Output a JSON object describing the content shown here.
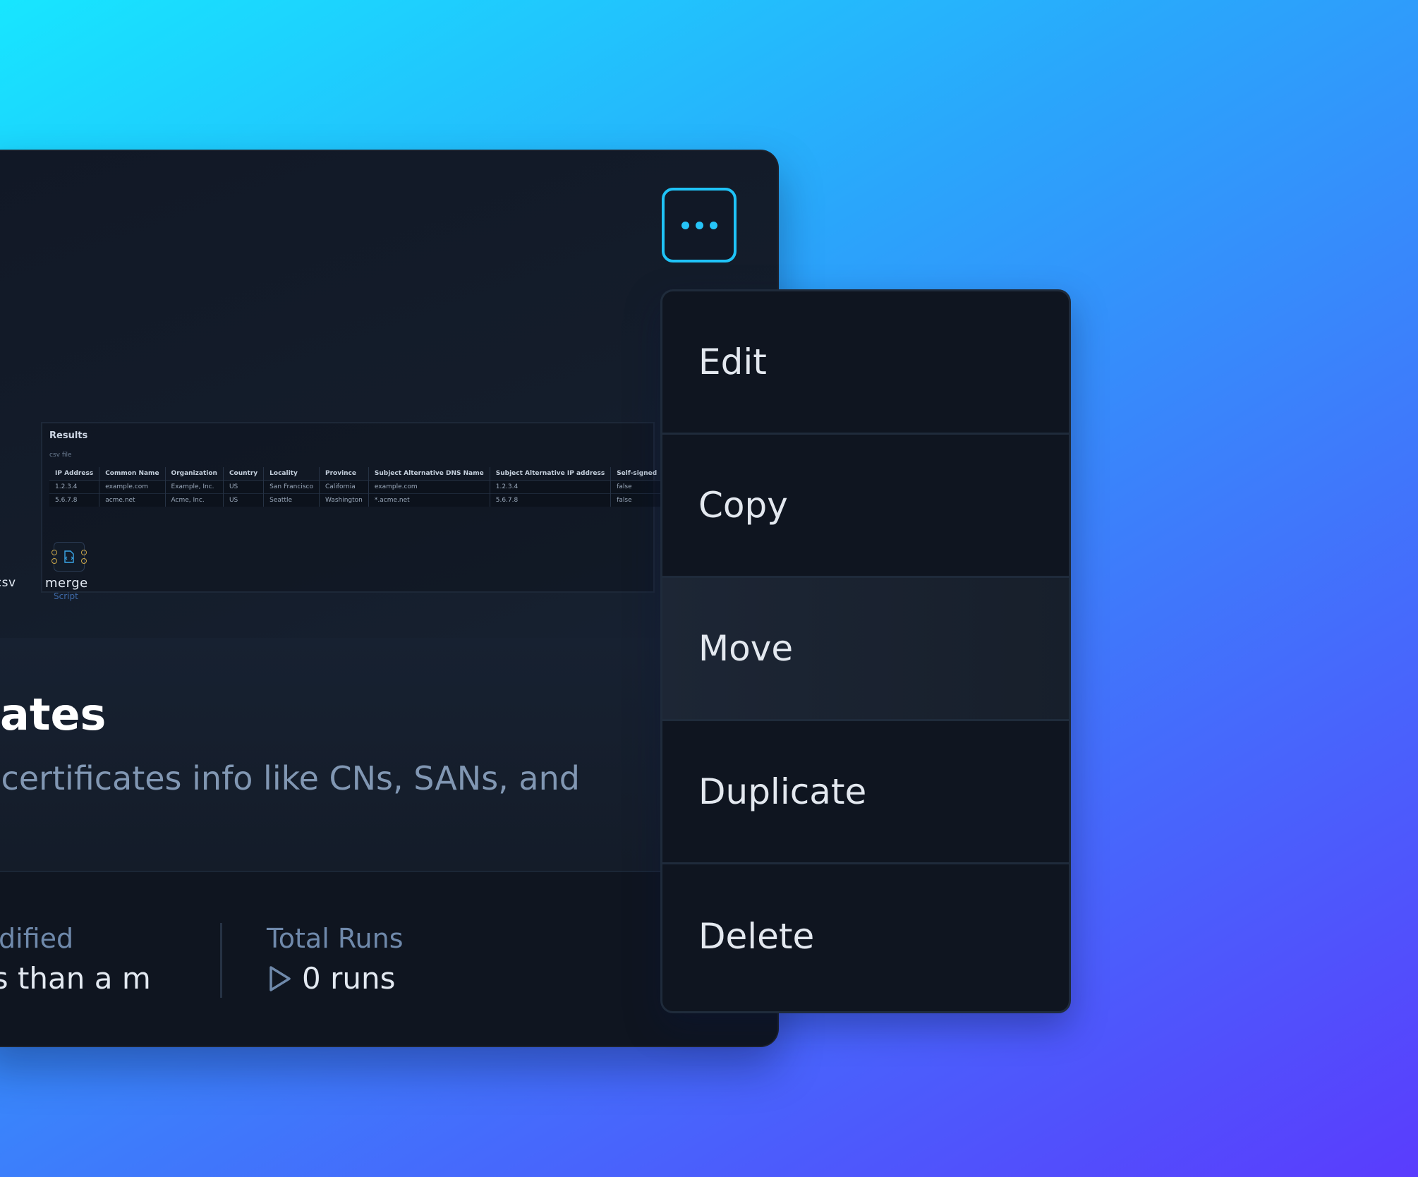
{
  "card": {
    "results": {
      "title": "Results",
      "subtitle": "csv file",
      "columns": [
        "IP Address",
        "Common Name",
        "Organization",
        "Country",
        "Locality",
        "Province",
        "Subject Alternative DNS Name",
        "Subject Alternative IP address",
        "Self-signed"
      ],
      "rows": [
        [
          "1.2.3.4",
          "example.com",
          "Example, Inc.",
          "US",
          "San Francisco",
          "California",
          "example.com",
          "1.2.3.4",
          "false"
        ],
        [
          "5.6.7.8",
          "acme.net",
          "Acme, Inc.",
          "US",
          "Seattle",
          "Washington",
          "*.acme.net",
          "5.6.7.8",
          "false"
        ]
      ]
    },
    "nodes": {
      "previous_label": "te-csv",
      "current_label": "merge",
      "current_type": "Script",
      "current_icon": "script-file-icon"
    },
    "title": "icates",
    "description": "SL certificates info like CNs, SANs, and",
    "stats": {
      "modified_label": "Modified",
      "modified_value": "ess than a m",
      "runs_label": "Total Runs",
      "runs_value": "0 runs",
      "runs_icon": "play-icon"
    },
    "more_icon": "ellipsis-icon"
  },
  "menu": {
    "items": [
      "Edit",
      "Copy",
      "Move",
      "Duplicate",
      "Delete"
    ],
    "highlighted": "Move"
  },
  "colors": {
    "accent": "#1fc3f7",
    "card_bg": "#0f1520",
    "stat_label": "#6f89ab"
  }
}
